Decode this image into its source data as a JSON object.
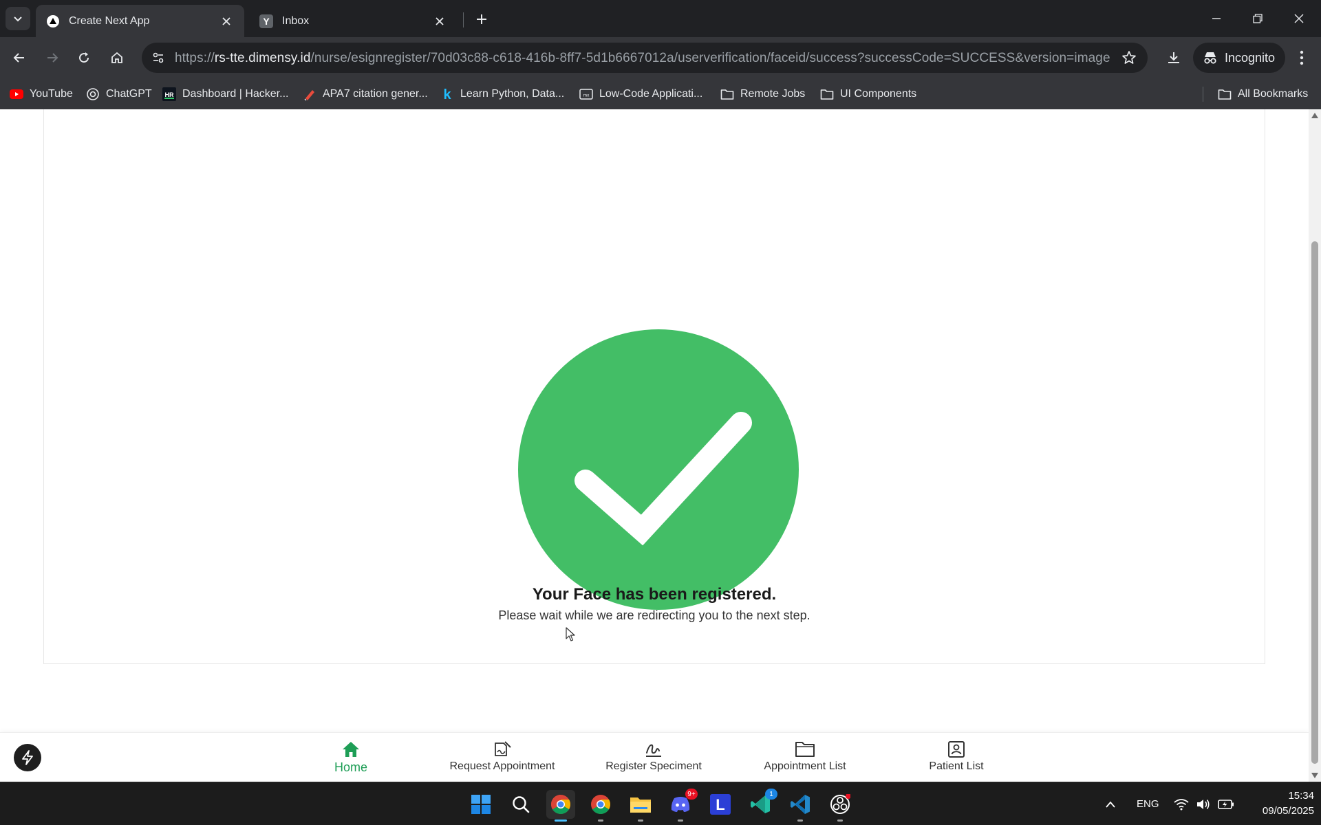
{
  "browser": {
    "tabs": [
      {
        "title": "Create Next App",
        "active": true
      },
      {
        "title": "Inbox",
        "active": false
      }
    ],
    "url": {
      "scheme": "https://",
      "host": "rs-tte.dimensy.id",
      "path": "/nurse/esignregister/70d03c88-c618-416b-8ff7-5d1b6667012a/userverification/faceid/success?successCode=SUCCESS&version=image"
    },
    "profile_label": "Incognito",
    "bookmarks": [
      {
        "label": "YouTube",
        "icon": "youtube-icon"
      },
      {
        "label": "ChatGPT",
        "icon": "chatgpt-icon"
      },
      {
        "label": "Dashboard | Hacker...",
        "icon": "hackerrank-icon"
      },
      {
        "label": "APA7 citation gener...",
        "icon": "citation-icon"
      },
      {
        "label": "Learn Python, Data...",
        "icon": "kaggle-icon"
      },
      {
        "label": "Low-Code Applicati...",
        "icon": "lowcode-icon"
      },
      {
        "label": "Remote Jobs",
        "icon": "folder-icon"
      },
      {
        "label": "UI Components",
        "icon": "folder-icon"
      }
    ],
    "all_bookmarks_label": "All Bookmarks"
  },
  "page": {
    "status": "success",
    "title": "Your Face has been registered.",
    "subtitle": "Please wait while we are redirecting you to the next step.",
    "accent_color": "#43be66",
    "bottom_nav": [
      {
        "label": "Home",
        "icon": "home-icon",
        "active": true
      },
      {
        "label": "Request Appointment",
        "icon": "signature-document-icon",
        "active": false
      },
      {
        "label": "Register Speciment",
        "icon": "signature-icon",
        "active": false
      },
      {
        "label": "Appointment List",
        "icon": "folder-icon",
        "active": false
      },
      {
        "label": "Patient List",
        "icon": "contact-icon",
        "active": false
      }
    ]
  },
  "taskbar": {
    "discord_badge": "9+",
    "vscode_insiders_badge": "1",
    "language": "ENG",
    "time": "15:34",
    "date": "09/05/2025"
  }
}
